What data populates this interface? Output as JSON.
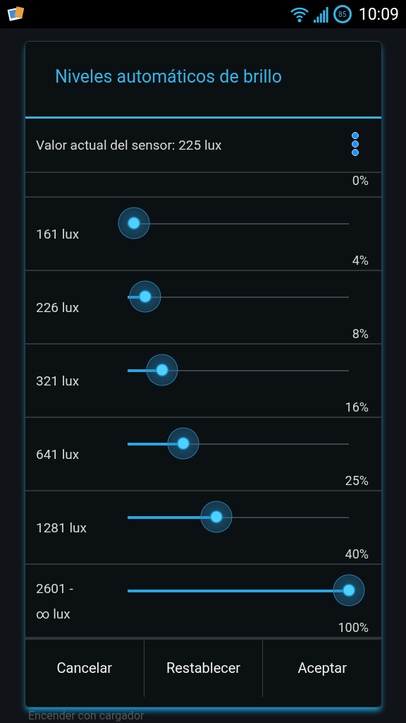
{
  "status_bar": {
    "battery": "85",
    "time": "10:09"
  },
  "dialog": {
    "title": "Niveles automáticos de brillo",
    "sensor": "Valor actual del sensor: 225 lux",
    "first_percent": "0%",
    "levels": [
      {
        "label": "161 lux",
        "level": 0.03,
        "percent": "4%"
      },
      {
        "label": "226 lux",
        "level": 0.08,
        "percent": "8%"
      },
      {
        "label": "321 lux",
        "level": 0.155,
        "percent": "16%"
      },
      {
        "label": "641 lux",
        "level": 0.25,
        "percent": "25%"
      },
      {
        "label": "1281 lux",
        "level": 0.4,
        "percent": "40%"
      },
      {
        "label": "2601 -\n∞ lux",
        "level": 1.0,
        "percent": "100%"
      }
    ],
    "buttons": [
      "Cancelar",
      "Restablecer",
      "Aceptar"
    ]
  },
  "background_item": "Encender con cargador"
}
